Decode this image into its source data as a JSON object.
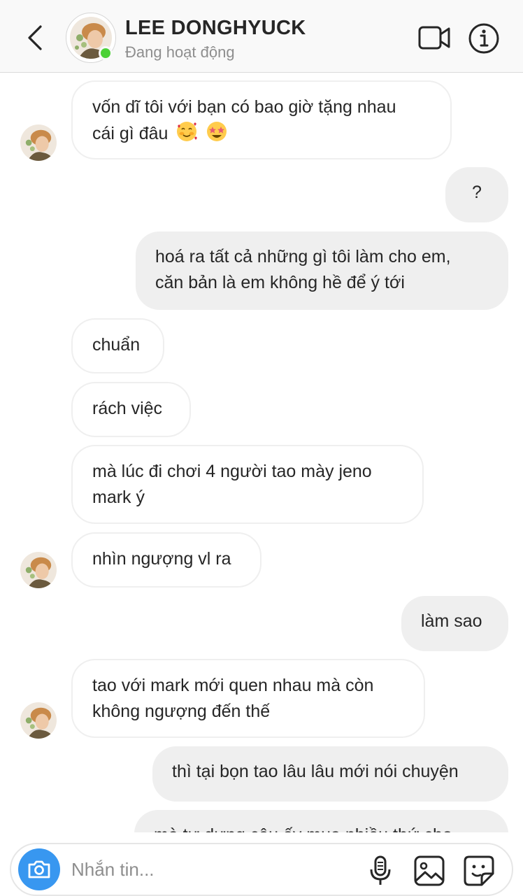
{
  "header": {
    "contact_name": "LEE DONGHYUCK",
    "status": "Đang hoạt động",
    "icons": {
      "back": "chevron-left-icon",
      "video": "video-camera-icon",
      "info": "info-icon"
    },
    "online_color": "#4cd137"
  },
  "messages": [
    {
      "side": "in",
      "lines": [
        "vốn dĩ tôi với bạn có bao giờ tặng nhau",
        "cái gì đâu"
      ],
      "emojis": [
        "smiling-face-with-hearts",
        "star-struck"
      ]
    },
    {
      "side": "out",
      "text": "?"
    },
    {
      "side": "out",
      "lines": [
        "hoá ra tất cả những gì tôi làm cho em,",
        "căn bản là em không hề để ý tới"
      ]
    },
    {
      "side": "in",
      "text": "chuẩn"
    },
    {
      "side": "in",
      "text": "rách việc"
    },
    {
      "side": "in",
      "lines": [
        "mà lúc đi chơi 4 người tao mày jeno",
        "mark ý"
      ]
    },
    {
      "side": "in",
      "text": "nhìn ngượng vl ra"
    },
    {
      "side": "out",
      "text": "làm sao"
    },
    {
      "side": "in",
      "lines": [
        "tao với mark mới quen nhau mà còn",
        "không ngượng đến thế"
      ]
    },
    {
      "side": "out",
      "text": "thì tại bọn tao lâu lâu mới nói chuyện"
    },
    {
      "side": "out",
      "text": "mà tự dưng cậu ấy mua nhiều thứ cho"
    }
  ],
  "composer": {
    "placeholder": "Nhắn tin...",
    "icons": {
      "camera": "camera-icon",
      "mic": "microphone-icon",
      "gallery": "image-icon",
      "sticker": "sticker-icon"
    },
    "camera_color": "#3897f0"
  },
  "colors": {
    "incoming_bubble_border": "#efefef",
    "outgoing_bubble_bg": "#efefef",
    "text": "#262626",
    "muted": "#8e8e8e"
  }
}
